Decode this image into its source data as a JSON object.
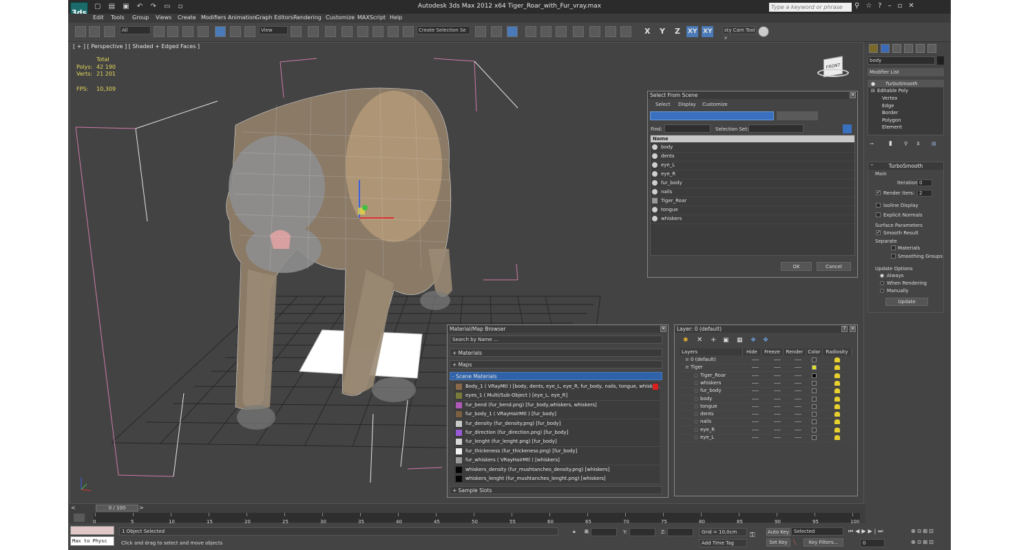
{
  "titlebar": {
    "app_logo": "3ds",
    "title": "Autodesk 3ds Max  2012 x64     Tiger_Roar_with_Fur_vray.max",
    "search_placeholder": "Type a keyword or phrase"
  },
  "menu": [
    "Edit",
    "Tools",
    "Group",
    "Views",
    "Create",
    "Modifiers",
    "Animation",
    "Graph Editors",
    "Rendering",
    "Customize",
    "MAXScript",
    "Help"
  ],
  "toolbar": {
    "filter": "All",
    "ref_coord": "View",
    "named_selection": "Create Selection Se",
    "axes": [
      "X",
      "Y",
      "Z",
      "XY",
      "XY"
    ],
    "plugin_label": "sty Cam Tool v"
  },
  "viewport": {
    "label": "[ + ] [ Perspective ] [ Shaded + Edged Faces ]",
    "stats_total_header": "Total",
    "stats": [
      {
        "label": "Polys:",
        "value": "42 190"
      },
      {
        "label": "Verts:",
        "value": "21 201"
      }
    ],
    "fps_label": "FPS:",
    "fps": "10,309",
    "viewcube_label": "FRONT"
  },
  "command_panel": {
    "object_name": "body",
    "modifier_list": "Modifier List",
    "stack": [
      {
        "label": "TurboSmooth",
        "level": 0
      },
      {
        "label": "Editable Poly",
        "level": 0
      },
      {
        "label": "Vertex",
        "level": 1
      },
      {
        "label": "Edge",
        "level": 1
      },
      {
        "label": "Border",
        "level": 1
      },
      {
        "label": "Polygon",
        "level": 1
      },
      {
        "label": "Element",
        "level": 1
      }
    ],
    "turbosmooth": {
      "title": "TurboSmooth",
      "main_label": "Main",
      "iterations_label": "Iterations:",
      "iterations": "0",
      "render_iters_label": "Render Iters:",
      "render_iters": "2",
      "isoline_label": "Isoline Display",
      "explicit_label": "Explicit Normals",
      "surface_params_label": "Surface Parameters",
      "smooth_result_label": "Smooth Result",
      "separate_label": "Separate",
      "materials_label": "Materials",
      "smoothing_groups_label": "Smoothing Groups",
      "update_options_label": "Update Options",
      "always_label": "Always",
      "when_rendering_label": "When Rendering",
      "manually_label": "Manually",
      "update_button": "Update"
    }
  },
  "select_from_scene": {
    "title": "Select From Scene",
    "menu": [
      "Select",
      "Display",
      "Customize"
    ],
    "find_label": "Find:",
    "selection_set_label": "Selection Set:",
    "column_name": "Name",
    "items": [
      "body",
      "dents",
      "eye_L",
      "eye_R",
      "fur_body",
      "nails",
      "Tiger_Roar",
      "tongue",
      "whiskers"
    ],
    "ok": "OK",
    "cancel": "Cancel"
  },
  "material_browser": {
    "title": "Material/Map Browser",
    "search_placeholder": "Search by Name ...",
    "sections": [
      "+ Materials",
      "+ Maps",
      "- Scene Materials",
      "+ Sample Slots"
    ],
    "items": [
      {
        "text": "Body_1  ( VRayMtl ) [body, dents, eye_L, eye_R, fur_body, nails, tongue, whiske...",
        "color": "#8a6a4a"
      },
      {
        "text": "eyes_1  ( Multi/Sub-Object ) [eye_L, eye_R]",
        "color": "#7a7a3a"
      },
      {
        "text": "fur_bend (fur_bend.png) [fur_body,whiskers, whiskers]",
        "color": "#b05ab8"
      },
      {
        "text": "fur_body_1  ( VRayHairMtl ) [fur_body]",
        "color": "#7a6040"
      },
      {
        "text": "fur_density (fur_density.png) [fur_body]",
        "color": "#c8c8c8"
      },
      {
        "text": "fur_direction (fur_direction.png) [fur_body]",
        "color": "#9a5ad8"
      },
      {
        "text": "fur_lenght (fur_lenght.png) [fur_body]",
        "color": "#d8d8d8"
      },
      {
        "text": "fur_thickeness (fur_thickeness.png) [fur_body]",
        "color": "#f2f2f2"
      },
      {
        "text": "fur_whiskers  ( VRayHairMtl ) [whiskers]",
        "color": "#9a9a9a"
      },
      {
        "text": "whiskers_density (fur_mushtanches_density.png) [whiskers]",
        "color": "#050505"
      },
      {
        "text": "whiskers_lenght (fur_mushtanches_lenght.png) [whiskers]",
        "color": "#050505"
      }
    ]
  },
  "layer_manager": {
    "title": "Layer: 0 (default)",
    "columns": [
      "Layers",
      "Hide",
      "Freeze",
      "Render",
      "Color",
      "Radiosity"
    ],
    "rows": [
      {
        "name": "0 (default)",
        "indent": 0,
        "color": "#3a3a3a"
      },
      {
        "name": "Tiger",
        "indent": 0,
        "color": "#e0e020"
      },
      {
        "name": "Tiger_Roar",
        "indent": 1,
        "color": "#050505"
      },
      {
        "name": "whiskers",
        "indent": 1,
        "color": "#3a3a3a"
      },
      {
        "name": "fur_body",
        "indent": 1,
        "color": "#3a3a3a"
      },
      {
        "name": "body",
        "indent": 1,
        "color": "#3a3a3a"
      },
      {
        "name": "tongue",
        "indent": 1,
        "color": "#3a3a3a"
      },
      {
        "name": "dents",
        "indent": 1,
        "color": "#3a3a3a"
      },
      {
        "name": "nails",
        "indent": 1,
        "color": "#3a3a3a"
      },
      {
        "name": "eye_R",
        "indent": 1,
        "color": "#3a3a3a"
      },
      {
        "name": "eye_L",
        "indent": 1,
        "color": "#3a3a3a"
      }
    ]
  },
  "timeline": {
    "frame": "0 / 100",
    "ticks": [
      "0",
      "5",
      "10",
      "15",
      "20",
      "25",
      "30",
      "35",
      "40",
      "45",
      "50",
      "55",
      "60",
      "65",
      "70",
      "75",
      "80",
      "85",
      "90",
      "95",
      "100"
    ]
  },
  "statusbar": {
    "maxscript_text": "Max to Physc",
    "status": "1 Object Selected",
    "prompt": "Click and drag to select and move objects",
    "x_label": "X:",
    "y_label": "Y:",
    "z_label": "Z:",
    "grid": "Grid = 10,0cm",
    "add_time_tag": "Add Time Tag",
    "auto_key": "Auto Key",
    "set_key": "Set Key",
    "selected": "Selected",
    "key_filters": "Key Filters...",
    "frame_value": "0"
  }
}
